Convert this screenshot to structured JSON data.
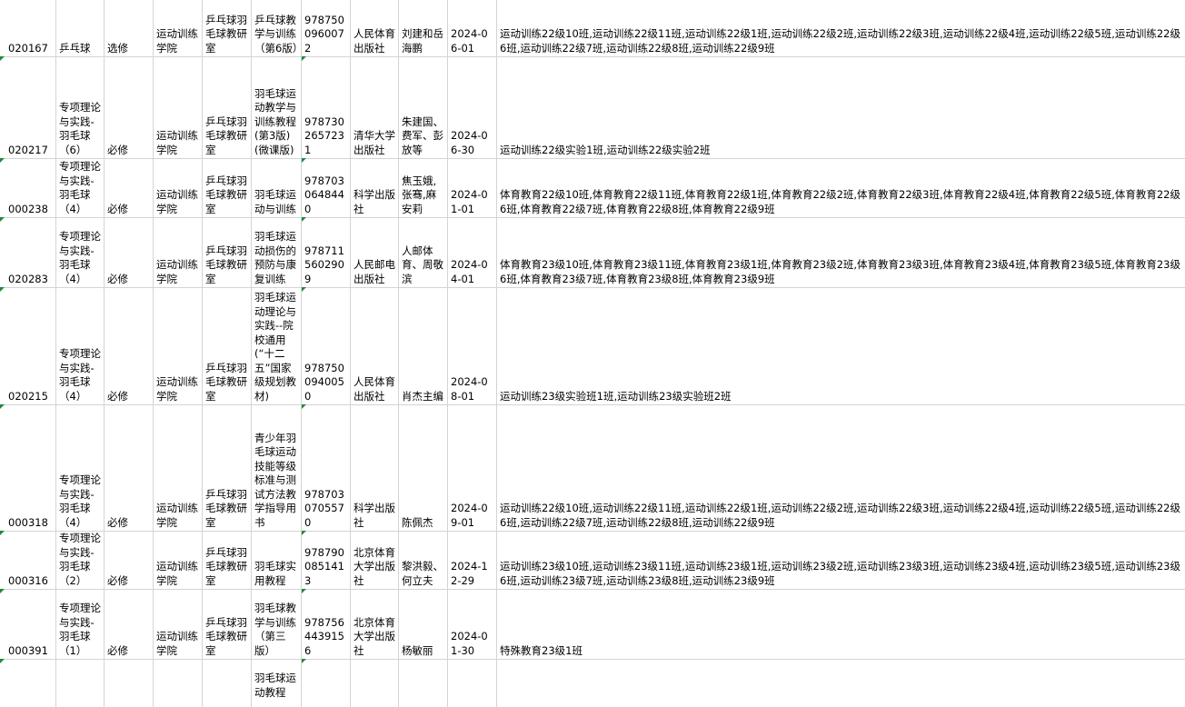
{
  "rows": [
    {
      "code": "020167",
      "course": "乒乓球",
      "type": "选修",
      "college": "运动训练学院",
      "dept": "乒乓球羽毛球教研室",
      "book": "乒乓球教学与训练（第6版）",
      "isbn": "9787500960072",
      "publisher": "人民体育出版社",
      "author": "刘建和岳海鹏",
      "date": "2024-06-01",
      "classes": "运动训练22级10班,运动训练22级11班,运动训练22级1班,运动训练22级2班,运动训练22级3班,运动训练22级4班,运动训练22级5班,运动训练22级6班,运动训练22级7班,运动训练22级8班,运动训练22级9班"
    },
    {
      "code": "020217",
      "course": "专项理论与实践-羽毛球（6）",
      "type": "必修",
      "college": "运动训练学院",
      "dept": "乒乓球羽毛球教研室",
      "book": "羽毛球运动教学与训练教程(第3版)(微课版)",
      "isbn": "9787302657231",
      "publisher": "清华大学出版社",
      "author": "朱建国、费军、彭放等",
      "date": "2024-06-30",
      "classes": "运动训练22级实验1班,运动训练22级实验2班"
    },
    {
      "code": "000238",
      "course": "专项理论与实践-羽毛球（4）",
      "type": "必修",
      "college": "运动训练学院",
      "dept": "乒乓球羽毛球教研室",
      "book": "羽毛球运动与训练",
      "isbn": "9787030648440",
      "publisher": "科学出版社",
      "author": "焦玉娥,张骞,麻安莉",
      "date": "2024-01-01",
      "classes": "体育教育22级10班,体育教育22级11班,体育教育22级1班,体育教育22级2班,体育教育22级3班,体育教育22级4班,体育教育22级5班,体育教育22级6班,体育教育22级7班,体育教育22级8班,体育教育22级9班"
    },
    {
      "code": "020283",
      "course": "专项理论与实践-羽毛球（4）",
      "type": "必修",
      "college": "运动训练学院",
      "dept": "乒乓球羽毛球教研室",
      "book": "羽毛球运动损伤的预防与康复训练",
      "isbn": "9787115602909",
      "publisher": "人民邮电出版社",
      "author": "人邮体育、周敬滨",
      "date": "2024-04-01",
      "classes": "体育教育23级10班,体育教育23级11班,体育教育23级1班,体育教育23级2班,体育教育23级3班,体育教育23级4班,体育教育23级5班,体育教育23级6班,体育教育23级7班,体育教育23级8班,体育教育23级9班"
    },
    {
      "code": "020215",
      "course": "专项理论与实践-羽毛球（4）",
      "type": "必修",
      "college": "运动训练学院",
      "dept": "乒乓球羽毛球教研室",
      "book": "羽毛球运动理论与实践--院校通用(“十二五”国家级规划教材)",
      "isbn": "9787500940050",
      "publisher": "人民体育出版社",
      "author": "肖杰主编",
      "date": "2024-08-01",
      "classes": "运动训练23级实验班1班,运动训练23级实验班2班"
    },
    {
      "code": "000318",
      "course": "专项理论与实践-羽毛球（4）",
      "type": "必修",
      "college": "运动训练学院",
      "dept": "乒乓球羽毛球教研室",
      "book": "青少年羽毛球运动技能等级标准与测试方法教学指导用书",
      "isbn": "9787030705570",
      "publisher": "科学出版社",
      "author": "陈佩杰",
      "date": "2024-09-01",
      "classes": "运动训练22级10班,运动训练22级11班,运动训练22级1班,运动训练22级2班,运动训练22级3班,运动训练22级4班,运动训练22级5班,运动训练22级6班,运动训练22级7班,运动训练22级8班,运动训练22级9班"
    },
    {
      "code": "000316",
      "course": "专项理论与实践-羽毛球（2）",
      "type": "必修",
      "college": "运动训练学院",
      "dept": "乒乓球羽毛球教研室",
      "book": "羽毛球实用教程",
      "isbn": "9787900851413",
      "publisher": "北京体育大学出版社",
      "author": "黎洪毅、何立夫",
      "date": "2024-12-29",
      "classes": "运动训练23级10班,运动训练23级11班,运动训练23级1班,运动训练23级2班,运动训练23级3班,运动训练23级4班,运动训练23级5班,运动训练23级6班,运动训练23级7班,运动训练23级8班,运动训练23级9班"
    },
    {
      "code": "000391",
      "course": "专项理论与实践-羽毛球（1）",
      "type": "必修",
      "college": "运动训练学院",
      "dept": "乒乓球羽毛球教研室",
      "book": "羽毛球教学与训练（第三版）",
      "isbn": "9787564439156",
      "publisher": "北京体育大学出版社",
      "author": "杨敏丽",
      "date": "2024-01-30",
      "classes": "特殊教育23级1班"
    },
    {
      "code": "",
      "course": "",
      "type": "",
      "college": "",
      "dept": "",
      "book": "羽毛球运动教程",
      "isbn": "",
      "publisher": "",
      "author": "",
      "date": "",
      "classes": ""
    }
  ]
}
